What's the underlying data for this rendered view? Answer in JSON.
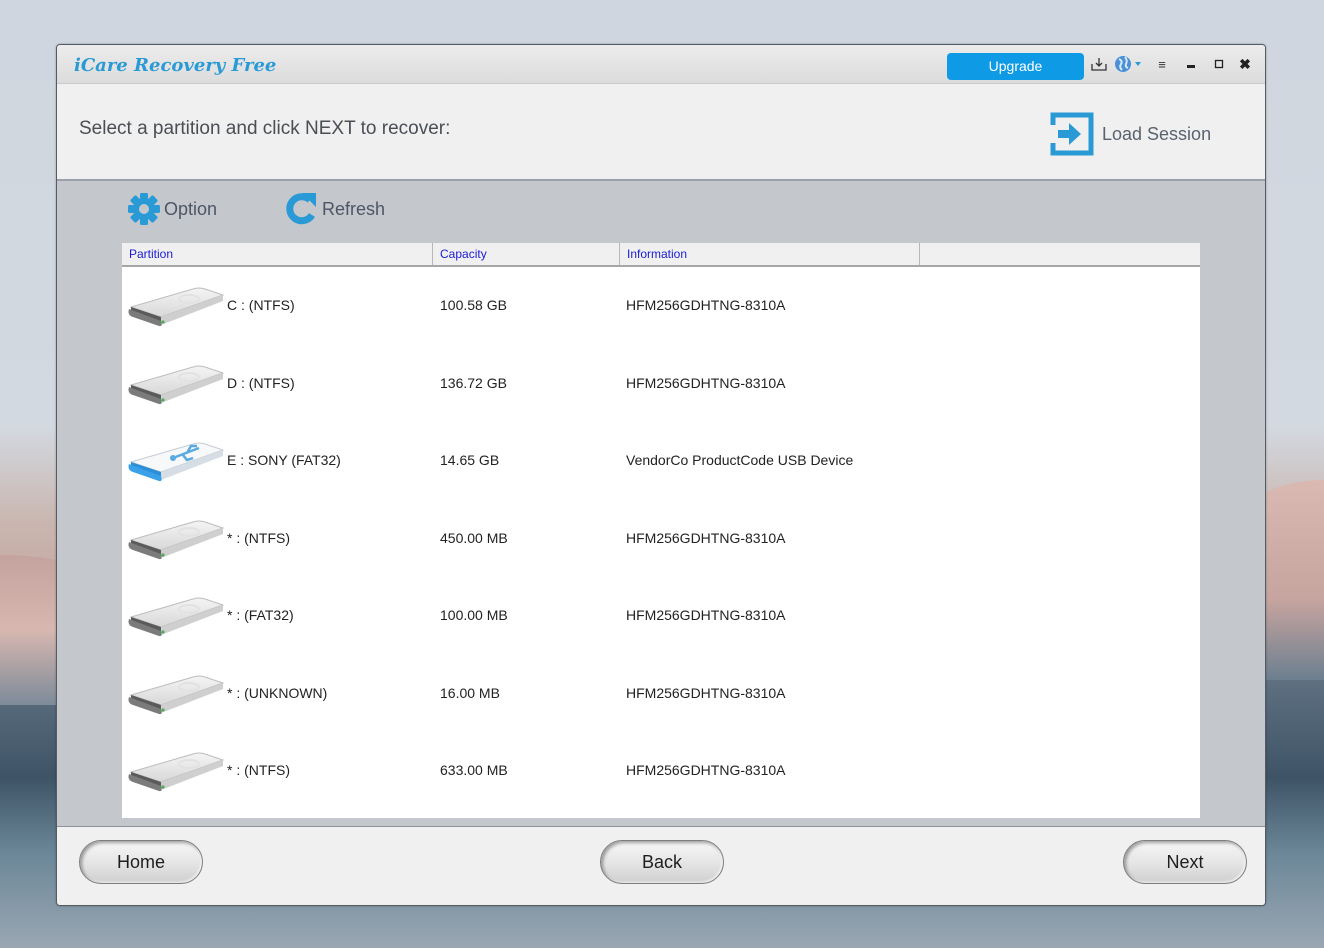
{
  "window": {
    "title": "iCare Recovery Free",
    "upgrade_label": "Upgrade",
    "controls": {
      "download": "download-icon",
      "language": "globe-icon",
      "menu": "≡",
      "minimize": "minimize-icon",
      "maximize": "maximize-icon",
      "close": "✖"
    }
  },
  "header": {
    "instruction": "Select a partition and click NEXT to recover:",
    "load_session_label": "Load Session"
  },
  "toolbar": {
    "option_label": "Option",
    "refresh_label": "Refresh"
  },
  "table": {
    "columns": [
      "Partition",
      "Capacity",
      "Information",
      ""
    ],
    "rows": [
      {
        "icon": "hard-drive",
        "partition": "C :  (NTFS)",
        "capacity": "100.58 GB",
        "information": "HFM256GDHTNG-8310A"
      },
      {
        "icon": "hard-drive",
        "partition": "D :  (NTFS)",
        "capacity": "136.72 GB",
        "information": "HFM256GDHTNG-8310A"
      },
      {
        "icon": "usb-drive",
        "partition": "E : SONY  (FAT32)",
        "capacity": "14.65 GB",
        "information": "VendorCo  ProductCode   USB Device"
      },
      {
        "icon": "hard-drive",
        "partition": "* :  (NTFS)",
        "capacity": "450.00 MB",
        "information": "HFM256GDHTNG-8310A"
      },
      {
        "icon": "hard-drive",
        "partition": "* :  (FAT32)",
        "capacity": "100.00 MB",
        "information": "HFM256GDHTNG-8310A"
      },
      {
        "icon": "hard-drive",
        "partition": "* :  (UNKNOWN)",
        "capacity": "16.00 MB",
        "information": "HFM256GDHTNG-8310A"
      },
      {
        "icon": "hard-drive",
        "partition": "* :  (NTFS)",
        "capacity": "633.00 MB",
        "information": "HFM256GDHTNG-8310A"
      }
    ]
  },
  "footer": {
    "home_label": "Home",
    "back_label": "Back",
    "next_label": "Next"
  },
  "colors": {
    "brand": "#2a9ad6",
    "upgrade": "#0f9ae6",
    "column_header_text": "#1a1ad6"
  }
}
